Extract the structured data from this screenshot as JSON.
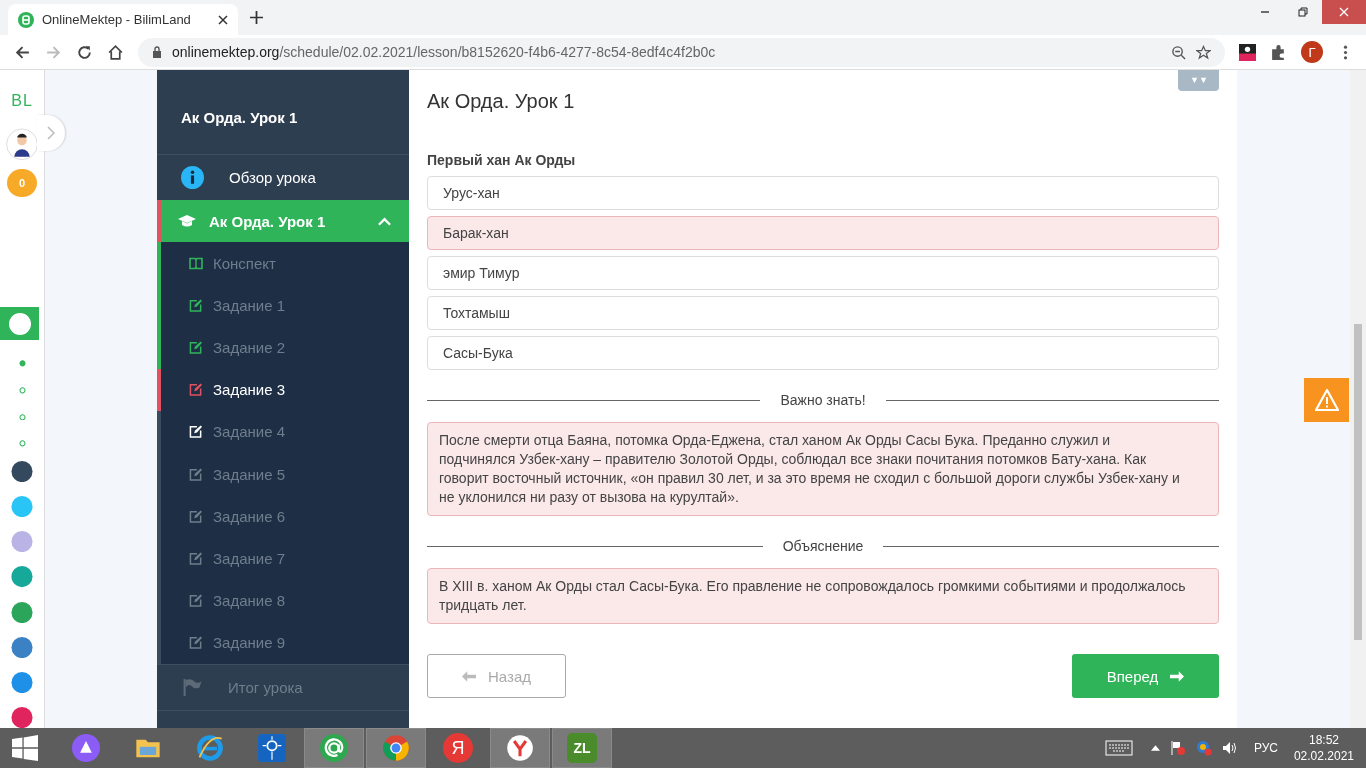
{
  "browser": {
    "tab_title": "OnlineMektep - BilimLand",
    "url_host": "onlinemektep.org",
    "url_path": "/schedule/02.02.2021/lesson/b8152620-f4b6-4277-8c54-8edf4c4f2b0c",
    "avatar_letter": "Г"
  },
  "rail": {
    "logo": "BL",
    "coins": "0",
    "dots": [
      {
        "selected": true
      },
      {
        "selected": false
      },
      {
        "selected": false
      },
      {
        "selected": false
      }
    ],
    "apps": [
      {
        "color": "#34495e"
      },
      {
        "color": "#29c5f6"
      },
      {
        "color": "#b9b3e6"
      },
      {
        "color": "#16a99a"
      },
      {
        "color": "#2aa55a"
      },
      {
        "color": "#3b82c4"
      },
      {
        "color": "#1e90e8"
      },
      {
        "color": "#e0245e"
      }
    ]
  },
  "sidebar": {
    "lesson_title": "Ак Орда. Урок 1",
    "overview": "Обзор урока",
    "module": {
      "label": "Ак Орда. Урок 1",
      "expanded": true,
      "children": [
        {
          "label": "Конспект",
          "kind": "notes",
          "color": "#2fb45a",
          "attempted": true,
          "selected": false
        },
        {
          "label": "Задание 1",
          "kind": "task",
          "color": "#2fb45a",
          "attempted": true,
          "selected": false
        },
        {
          "label": "Задание 2",
          "kind": "task",
          "color": "#2fb45a",
          "attempted": true,
          "selected": false
        },
        {
          "label": "Задание 3",
          "kind": "task",
          "color": "#e0525f",
          "attempted": true,
          "selected": true
        },
        {
          "label": "Задание 4",
          "kind": "task",
          "color": "#ffffff",
          "attempted": false,
          "selected": false
        },
        {
          "label": "Задание 5",
          "kind": "task",
          "color": "#6f7d8c",
          "attempted": false,
          "selected": false
        },
        {
          "label": "Задание 6",
          "kind": "task",
          "color": "#6f7d8c",
          "attempted": false,
          "selected": false
        },
        {
          "label": "Задание 7",
          "kind": "task",
          "color": "#6f7d8c",
          "attempted": false,
          "selected": false
        },
        {
          "label": "Задание 8",
          "kind": "task",
          "color": "#6f7d8c",
          "attempted": false,
          "selected": false
        },
        {
          "label": "Задание 9",
          "kind": "task",
          "color": "#6f7d8c",
          "attempted": false,
          "selected": false
        }
      ]
    },
    "summary": "Итог урока"
  },
  "main": {
    "title": "Ак Орда. Урок 1",
    "question": "Первый хан Ак Орды",
    "options": [
      {
        "text": "Урус-хан",
        "selected": false
      },
      {
        "text": "Барак-хан",
        "selected": true
      },
      {
        "text": "эмир Тимур",
        "selected": false
      },
      {
        "text": "Тохтамыш",
        "selected": false
      },
      {
        "text": "Сасы-Бука",
        "selected": false
      }
    ],
    "sections": [
      {
        "heading": "Важно знать!",
        "text": "После смерти отца Баяна, потомка Орда-Еджена, стал ханом Ак Орды Сасы Бука. Преданно служил и подчинялся Узбек-хану – правителю Золотой Орды, соблюдал все знаки почитания потомков Бату-хана. Как говорит восточный источник, «он правил 30 лет, и за это время не сходил с большой дороги службы Узбек-хану и не уклонился ни разу от вызова на курултай»."
      },
      {
        "heading": "Объяснение",
        "text": "В XIII в. ханом Ак Орды стал Сасы-Бука. Его правление не сопровождалось громкими событиями и продолжалось тридцать лет."
      }
    ],
    "back": "Назад",
    "next": "Вперед"
  },
  "taskbar": {
    "apps": [
      {
        "kind": "alice",
        "selected": false
      },
      {
        "kind": "explorer",
        "selected": false
      },
      {
        "kind": "ie",
        "selected": false
      },
      {
        "kind": "settings",
        "selected": false
      },
      {
        "kind": "mail",
        "selected": true
      },
      {
        "kind": "chrome",
        "selected": true
      },
      {
        "kind": "yandex",
        "selected": false,
        "text": "Я"
      },
      {
        "kind": "ybrowser",
        "selected": true
      },
      {
        "kind": "game",
        "selected": true,
        "text": "ZL"
      }
    ],
    "lang": "РУС",
    "time": "18:52",
    "date": "02.02.2021"
  }
}
